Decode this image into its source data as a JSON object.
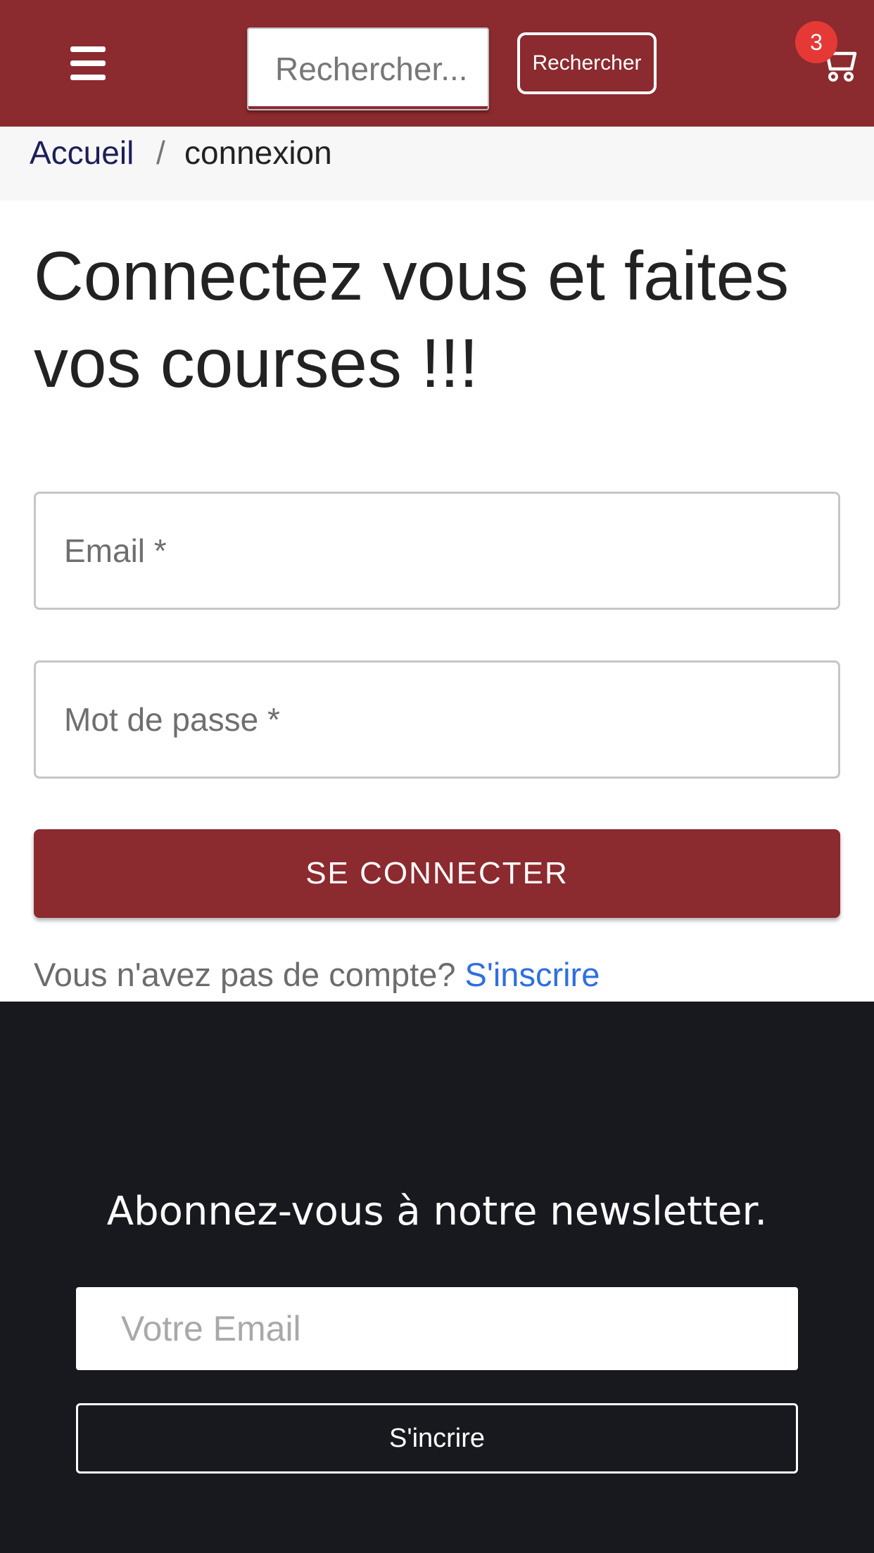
{
  "header": {
    "menu_icon": "hamburger-menu-icon",
    "search": {
      "placeholder": "Rechercher...",
      "value": ""
    },
    "search_button_label": "Rechercher",
    "cart": {
      "icon": "shopping-cart-icon",
      "count": "3"
    },
    "colors": {
      "brand": "#8b2a2f",
      "badge": "#e53935"
    }
  },
  "breadcrumb": {
    "home_label": "Accueil",
    "separator": "/",
    "current_label": "connexion"
  },
  "main": {
    "title": "Connectez vous et faites vos courses !!!",
    "email_field": {
      "placeholder": "Email *",
      "value": ""
    },
    "password_field": {
      "placeholder": "Mot de passe *",
      "value": ""
    },
    "login_button_label": "SE CONNECTER",
    "signup_prompt": "Vous n'avez pas de compte?",
    "signup_link_label": "S'inscrire",
    "colors": {
      "link": "#2f6fe0"
    }
  },
  "footer": {
    "newsletter_title": "Abonnez-vous à notre newsletter.",
    "newsletter_input": {
      "placeholder": "Votre Email",
      "value": ""
    },
    "subscribe_button_label": "S'incrire",
    "colors": {
      "background": "#18191e"
    }
  }
}
